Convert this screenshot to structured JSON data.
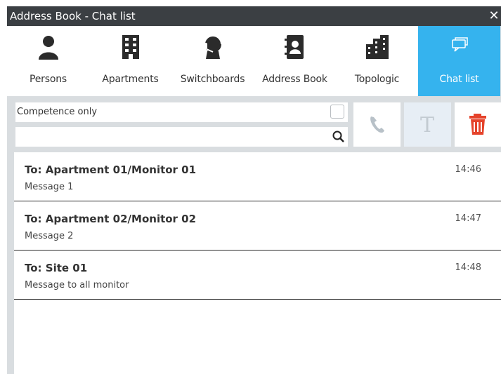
{
  "window": {
    "title": "Address Book - Chat list",
    "close_icon": "close-icon"
  },
  "tabs": [
    {
      "label": "Persons",
      "icon": "person-icon",
      "active": false
    },
    {
      "label": "Apartments",
      "icon": "building-icon",
      "active": false
    },
    {
      "label": "Switchboards",
      "icon": "headset-icon",
      "active": false
    },
    {
      "label": "Address Book",
      "icon": "address-book-icon",
      "active": false
    },
    {
      "label": "Topologic",
      "icon": "buildings-icon",
      "active": false
    },
    {
      "label": "Chat list",
      "icon": "chat-icon",
      "active": true
    }
  ],
  "filters": {
    "competence_label": "Competence only",
    "competence_checked": false,
    "search_value": "",
    "search_icon": "search-icon"
  },
  "actions": {
    "call_icon": "phone-icon",
    "text_icon": "text-icon",
    "delete_icon": "trash-icon"
  },
  "messages": [
    {
      "to": "To: Apartment 01/Monitor 01",
      "message": "Message 1",
      "time": "14:46"
    },
    {
      "to": "To: Apartment 02/Monitor 02",
      "message": "Message 2",
      "time": "14:47"
    },
    {
      "to": "To: Site 01",
      "message": "Message to all monitor",
      "time": "14:48"
    }
  ],
  "colors": {
    "accent": "#35b3ee",
    "titlebar": "#3b3f43",
    "delete": "#e5432b",
    "background": "#d9dde0"
  }
}
